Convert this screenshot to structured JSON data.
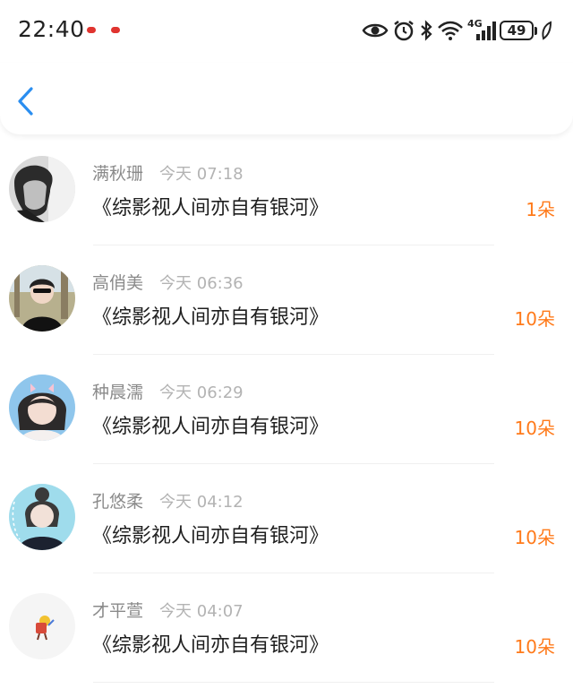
{
  "status": {
    "time": "22:40",
    "network": "4G",
    "battery": "49"
  },
  "colors": {
    "accent": "#2a8ef0",
    "amount": "#ff7a1a",
    "name": "#8a8a8a",
    "time": "#b3b3b3"
  },
  "nav": {
    "back_icon": "chevron-left-icon"
  },
  "items": [
    {
      "name": "满秋珊",
      "time": "今天 07:18",
      "title": "《综影视人间亦自有银河》",
      "amount": "1朵"
    },
    {
      "name": "高俏美",
      "time": "今天 06:36",
      "title": "《综影视人间亦自有银河》",
      "amount": "10朵"
    },
    {
      "name": "种晨濡",
      "time": "今天 06:29",
      "title": "《综影视人间亦自有银河》",
      "amount": "10朵"
    },
    {
      "name": "孔悠柔",
      "time": "今天 04:12",
      "title": "《综影视人间亦自有银河》",
      "amount": "10朵"
    },
    {
      "name": "才平萱",
      "time": "今天 04:07",
      "title": "《综影视人间亦自有银河》",
      "amount": "10朵"
    }
  ]
}
